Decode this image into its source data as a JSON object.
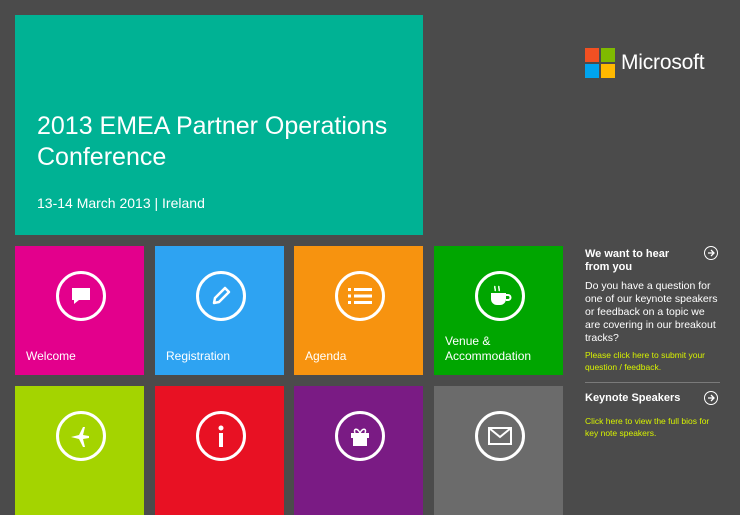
{
  "hero": {
    "title": "2013 EMEA Partner Operations Conference",
    "subtitle": "13-14 March 2013 | Ireland",
    "color": "#00b294"
  },
  "logo": {
    "text": "Microsoft",
    "colors": [
      "#f25022",
      "#7fba00",
      "#00a4ef",
      "#ffb900"
    ]
  },
  "tiles": [
    {
      "label": "Welcome",
      "icon": "chat-bubble-icon",
      "color": "#e3008c"
    },
    {
      "label": "Registration",
      "icon": "pencil-icon",
      "color": "#2ea3f2"
    },
    {
      "label": "Agenda",
      "icon": "list-icon",
      "color": "#f7930f"
    },
    {
      "label": "Venue & Accommodation",
      "icon": "coffee-cup-icon",
      "color": "#00a600"
    },
    {
      "label": "",
      "icon": "airplane-icon",
      "color": "#a4d400"
    },
    {
      "label": "",
      "icon": "info-icon",
      "color": "#e81123"
    },
    {
      "label": "",
      "icon": "gift-icon",
      "color": "#7a1b84"
    },
    {
      "label": "",
      "icon": "mail-icon",
      "color": "#6b6b6b"
    }
  ],
  "sidebar": {
    "feedback": {
      "heading": "We want to hear from you",
      "body": "Do you have a question for one of our keynote speakers or feedback on a topic we are covering in our breakout tracks?",
      "link": "Please click here to submit your question / feedback."
    },
    "keynote": {
      "heading": "Keynote Speakers",
      "link": "Click here to view the full bios for key note speakers."
    }
  }
}
